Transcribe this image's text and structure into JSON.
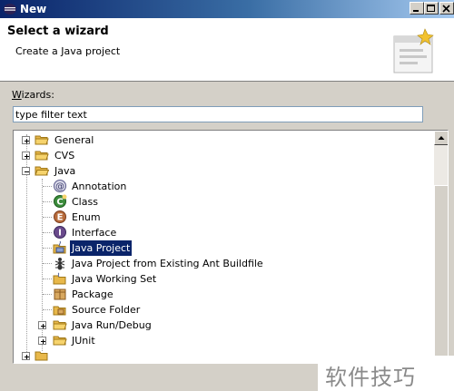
{
  "window": {
    "title": "New"
  },
  "header": {
    "title": "Select a wizard",
    "description": "Create a Java project"
  },
  "wizards": {
    "label_accesskey": "W",
    "label_rest": "izards:",
    "filter_value": "type filter text"
  },
  "tree": {
    "items": [
      {
        "label": "General"
      },
      {
        "label": "CVS"
      },
      {
        "label": "Java"
      },
      {
        "label": "Annotation"
      },
      {
        "label": "Class"
      },
      {
        "label": "Enum"
      },
      {
        "label": "Interface"
      },
      {
        "label": "Java Project"
      },
      {
        "label": "Java Project from Existing Ant Buildfile"
      },
      {
        "label": "Java Working Set"
      },
      {
        "label": "Package"
      },
      {
        "label": "Source Folder"
      },
      {
        "label": "Java Run/Debug"
      },
      {
        "label": "JUnit"
      }
    ],
    "selected": "Java Project"
  },
  "watermark": {
    "text": "软件技巧"
  },
  "colors": {
    "title_bar": "#0a246a",
    "selection": "#0a246a",
    "dialog_bg": "#d4d0c8"
  }
}
